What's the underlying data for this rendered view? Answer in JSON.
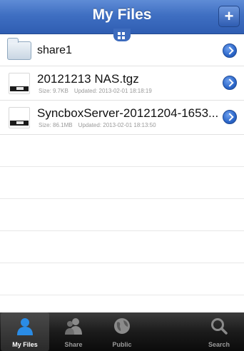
{
  "header": {
    "title": "My Files",
    "add_label": "+"
  },
  "files": [
    {
      "name": "share1",
      "type": "folder"
    },
    {
      "name": "20121213 NAS.tgz",
      "type": "file",
      "size": "Size: 9.7KB",
      "updated": "Updated: 2013-02-01 18:18:19",
      "icon_label": "FILE"
    },
    {
      "name": "SyncboxServer-20121204-1653...",
      "type": "file",
      "size": "Size: 86.1MB",
      "updated": "Updated: 2013-02-01 18:13:50",
      "icon_label": "FILE"
    }
  ],
  "tabs": [
    {
      "label": "My Files",
      "icon": "person-icon",
      "active": true
    },
    {
      "label": "Share",
      "icon": "people-icon",
      "active": false
    },
    {
      "label": "Public",
      "icon": "globe-icon",
      "active": false
    },
    {
      "label": "Search",
      "icon": "search-icon",
      "active": false
    }
  ],
  "colors": {
    "nav_blue": "#3f6fc2",
    "chevron_blue": "#2b66c9",
    "tabbar_dark": "#1b1b1b",
    "tab_active_icon": "#2a8ce6"
  }
}
